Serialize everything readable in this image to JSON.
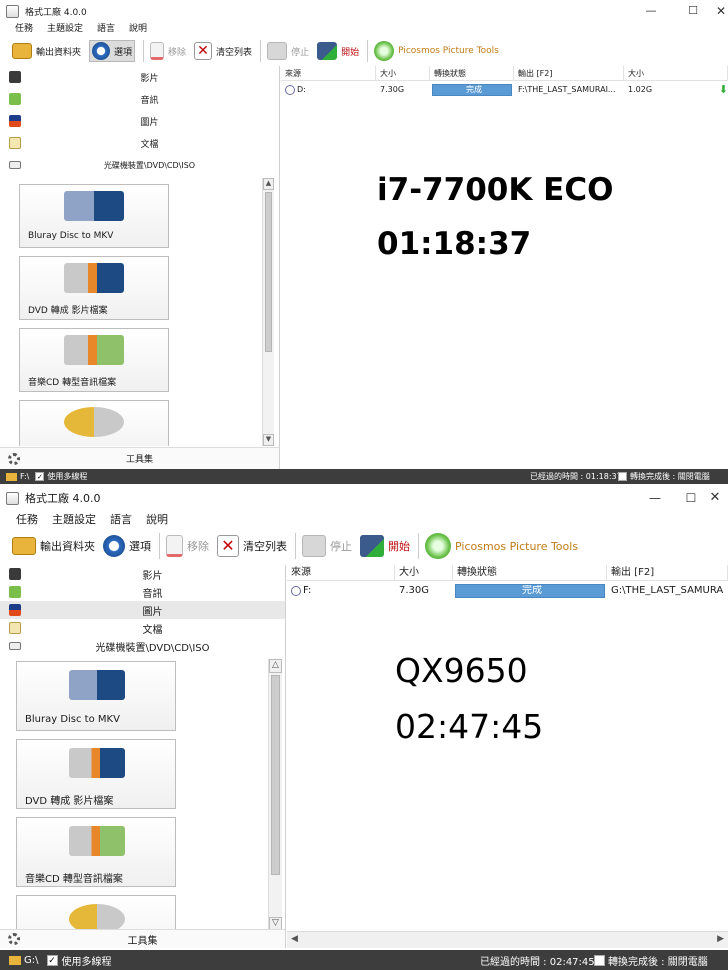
{
  "w1": {
    "title": "格式工廠 4.0.0",
    "menu": [
      "任務",
      "主題設定",
      "語言",
      "說明"
    ],
    "toolbar": {
      "output_folder": "輸出資料夾",
      "options": "選項",
      "remove": "移除",
      "clear_list": "清空列表",
      "stop": "停止",
      "start": "開始",
      "picosmos": "Picosmos Picture Tools"
    },
    "categories": [
      "影片",
      "音訊",
      "圖片",
      "文檔",
      "光碟機裝置\\DVD\\CD\\ISO"
    ],
    "cards": [
      "Bluray Disc to MKV",
      "DVD 轉成 影片檔案",
      "音樂CD 轉型音訊檔案"
    ],
    "tools": "工具集",
    "headers": [
      "來源",
      "大小",
      "轉換狀態",
      "輸出 [F2]",
      "大小"
    ],
    "row": {
      "source": "D:",
      "size": "7.30G",
      "status": "完成",
      "output": "F:\\THE_LAST_SAMURAI...",
      "out_size": "1.02G"
    },
    "overlay": {
      "line1": "i7-7700K ECO",
      "line2": "01:18:37"
    },
    "status": {
      "drive": "F:\\",
      "multithread": "使用多線程",
      "elapsed": "已經過的時間 : 01:18:37",
      "after": "轉換完成後 : 關閉電腦"
    }
  },
  "w2": {
    "title": "格式工廠 4.0.0",
    "menu": [
      "任務",
      "主題設定",
      "語言",
      "說明"
    ],
    "toolbar": {
      "output_folder": "輸出資料夾",
      "options": "選項",
      "remove": "移除",
      "clear_list": "清空列表",
      "stop": "停止",
      "start": "開始",
      "picosmos": "Picosmos Picture Tools"
    },
    "categories": [
      "影片",
      "音訊",
      "圖片",
      "文檔",
      "光碟機裝置\\DVD\\CD\\ISO"
    ],
    "cards": [
      "Bluray Disc to MKV",
      "DVD 轉成 影片檔案",
      "音樂CD 轉型音訊檔案"
    ],
    "tools": "工具集",
    "headers": [
      "來源",
      "大小",
      "轉換狀態",
      "輸出 [F2]"
    ],
    "row": {
      "source": "F:",
      "size": "7.30G",
      "status": "完成",
      "output": "G:\\THE_LAST_SAMURA"
    },
    "overlay": {
      "line1": "QX9650",
      "line2": "02:47:45"
    },
    "status": {
      "drive": "G:\\",
      "multithread": "使用多線程",
      "elapsed": "已經過的時間 : 02:47:45",
      "after": "轉換完成後 : 關閉電腦"
    }
  }
}
